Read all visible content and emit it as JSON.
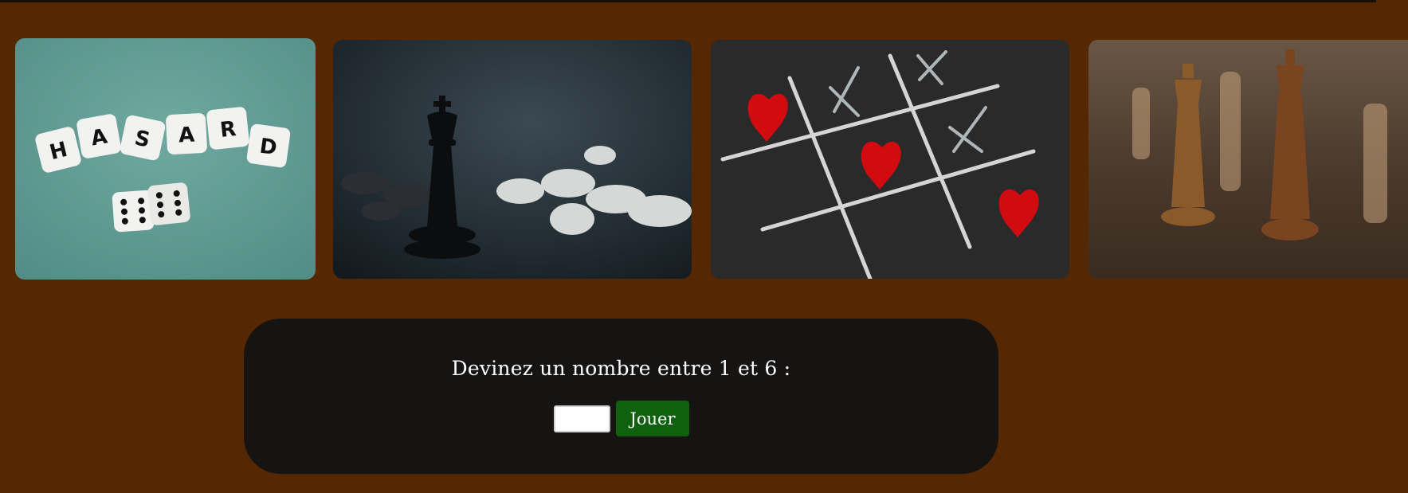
{
  "gallery": {
    "images": [
      {
        "subject": "dice-hasard",
        "letters": [
          "H",
          "A",
          "S",
          "A",
          "R",
          "D"
        ]
      },
      {
        "subject": "chess-king-dark"
      },
      {
        "subject": "tic-tac-toe-hearts"
      },
      {
        "subject": "chess-wood-pieces"
      }
    ]
  },
  "game": {
    "prompt": "Devinez un nombre entre 1 et 6 :",
    "input_value": "",
    "play_label": "Jouer"
  },
  "colors": {
    "page_background": "#552702",
    "panel_background": "#161313",
    "button_background": "#10610f"
  }
}
